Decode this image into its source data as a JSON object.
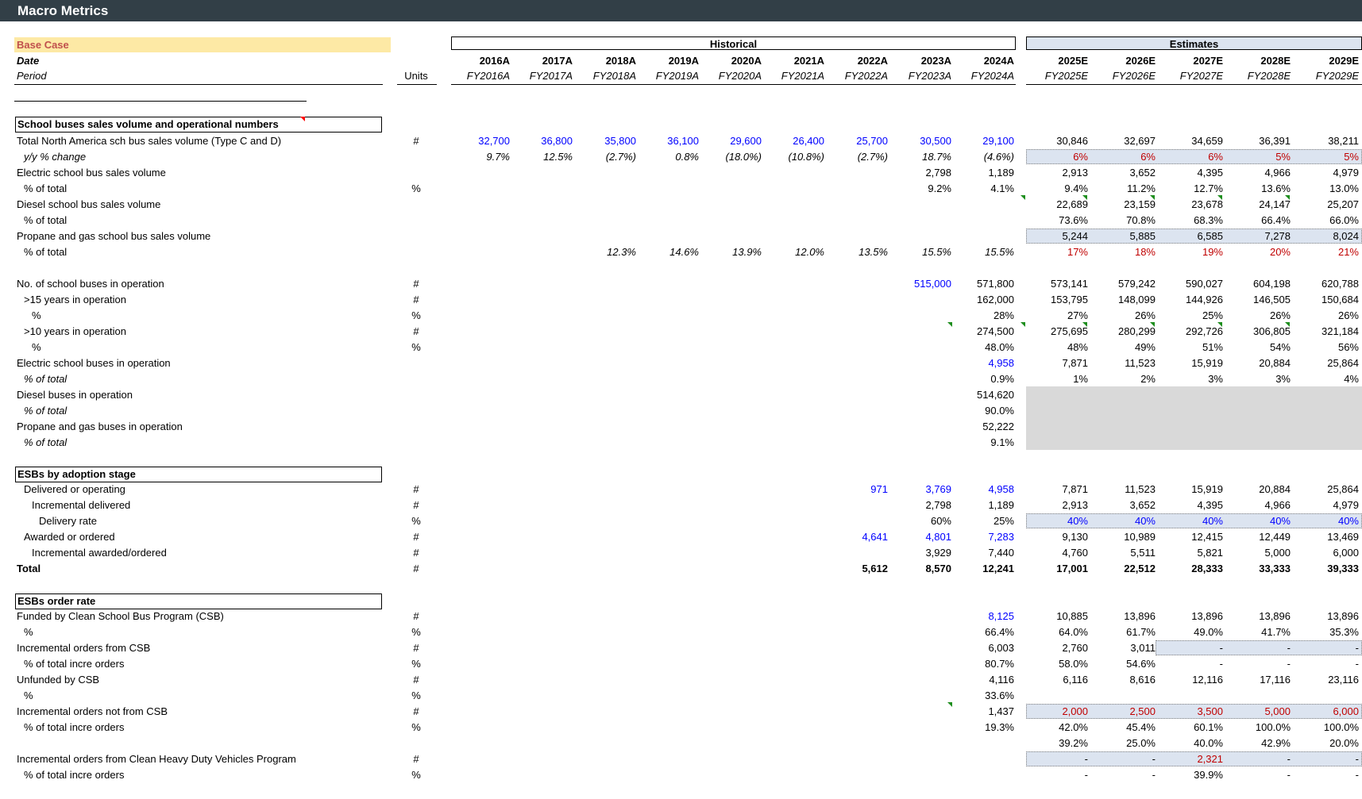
{
  "sheet_title": "Macro Metrics",
  "base_case": "Base Case",
  "date_label": "Date",
  "period_label": "Period",
  "units_header": "Units",
  "historical_label": "Historical",
  "estimates_label": "Estimates",
  "years": [
    "2016A",
    "2017A",
    "2018A",
    "2019A",
    "2020A",
    "2021A",
    "2022A",
    "2023A",
    "2024A",
    "2025E",
    "2026E",
    "2027E",
    "2028E",
    "2029E"
  ],
  "periods": [
    "FY2016A",
    "FY2017A",
    "FY2018A",
    "FY2019A",
    "FY2020A",
    "FY2021A",
    "FY2022A",
    "FY2023A",
    "FY2024A",
    "FY2025E",
    "FY2026E",
    "FY2027E",
    "FY2028E",
    "FY2029E"
  ],
  "sections": [
    {
      "title": "School buses sales volume and operational numbers"
    },
    {
      "title": "ESBs by adoption stage"
    },
    {
      "title": "ESBs order rate"
    }
  ],
  "rows": [
    {
      "label": "Total North America sch bus sales volume (Type C and D)",
      "unit": "#",
      "vals": [
        "32,700",
        "36,800",
        "35,800",
        "36,100",
        "29,600",
        "26,400",
        "25,700",
        "30,500",
        "29,100",
        "30,846",
        "32,697",
        "34,659",
        "36,391",
        "38,211"
      ]
    },
    {
      "label": "y/y % change",
      "unit": "",
      "vals": [
        "9.7%",
        "12.5%",
        "(2.7%)",
        "0.8%",
        "(18.0%)",
        "(10.8%)",
        "(2.7%)",
        "18.7%",
        "(4.6%)",
        "6%",
        "6%",
        "6%",
        "5%",
        "5%"
      ]
    },
    {
      "label": "Electric school bus sales volume",
      "unit": "",
      "vals": [
        "",
        "",
        "",
        "",
        "",
        "",
        "",
        "2,798",
        "1,189",
        "2,913",
        "3,652",
        "4,395",
        "4,966",
        "4,979"
      ]
    },
    {
      "label": "% of total",
      "unit": "%",
      "vals": [
        "",
        "",
        "",
        "",
        "",
        "",
        "",
        "9.2%",
        "4.1%",
        "9.4%",
        "11.2%",
        "12.7%",
        "13.6%",
        "13.0%"
      ]
    },
    {
      "label": "Diesel school bus sales volume",
      "unit": "",
      "vals": [
        "",
        "",
        "",
        "",
        "",
        "",
        "",
        "",
        "",
        "22,689",
        "23,159",
        "23,678",
        "24,147",
        "25,207"
      ]
    },
    {
      "label": "% of total",
      "unit": "",
      "vals": [
        "",
        "",
        "",
        "",
        "",
        "",
        "",
        "",
        "",
        "73.6%",
        "70.8%",
        "68.3%",
        "66.4%",
        "66.0%"
      ]
    },
    {
      "label": "Propane and gas school bus sales volume",
      "unit": "",
      "vals": [
        "",
        "",
        "",
        "",
        "",
        "",
        "",
        "",
        "",
        "5,244",
        "5,885",
        "6,585",
        "7,278",
        "8,024"
      ]
    },
    {
      "label": "% of total",
      "unit": "",
      "vals": [
        "",
        "",
        "12.3%",
        "14.6%",
        "13.9%",
        "12.0%",
        "13.5%",
        "15.5%",
        "15.5%",
        "17%",
        "18%",
        "19%",
        "20%",
        "21%"
      ]
    },
    {
      "label": "No. of school buses in operation",
      "unit": "#",
      "vals": [
        "",
        "",
        "",
        "",
        "",
        "",
        "",
        "515,000",
        "571,800",
        "573,141",
        "579,242",
        "590,027",
        "604,198",
        "620,788"
      ]
    },
    {
      "label": ">15 years in operation",
      "unit": "#",
      "vals": [
        "",
        "",
        "",
        "",
        "",
        "",
        "",
        "",
        "162,000",
        "153,795",
        "148,099",
        "144,926",
        "146,505",
        "150,684"
      ]
    },
    {
      "label": "%",
      "unit": "%",
      "vals": [
        "",
        "",
        "",
        "",
        "",
        "",
        "",
        "",
        "28%",
        "27%",
        "26%",
        "25%",
        "26%",
        "26%"
      ]
    },
    {
      "label": ">10 years in operation",
      "unit": "#",
      "vals": [
        "",
        "",
        "",
        "",
        "",
        "",
        "",
        "",
        "274,500",
        "275,695",
        "280,299",
        "292,726",
        "306,805",
        "321,184"
      ]
    },
    {
      "label": "%",
      "unit": "%",
      "vals": [
        "",
        "",
        "",
        "",
        "",
        "",
        "",
        "",
        "48.0%",
        "48%",
        "49%",
        "51%",
        "54%",
        "56%"
      ]
    },
    {
      "label": "Electric school buses in operation",
      "unit": "",
      "vals": [
        "",
        "",
        "",
        "",
        "",
        "",
        "",
        "",
        "4,958",
        "7,871",
        "11,523",
        "15,919",
        "20,884",
        "25,864"
      ]
    },
    {
      "label": "% of total",
      "unit": "",
      "vals": [
        "",
        "",
        "",
        "",
        "",
        "",
        "",
        "",
        "0.9%",
        "1%",
        "2%",
        "3%",
        "3%",
        "4%"
      ]
    },
    {
      "label": "Diesel buses in operation",
      "unit": "",
      "vals": [
        "",
        "",
        "",
        "",
        "",
        "",
        "",
        "",
        "514,620",
        "",
        "",
        "",
        "",
        ""
      ]
    },
    {
      "label": "% of total",
      "unit": "",
      "vals": [
        "",
        "",
        "",
        "",
        "",
        "",
        "",
        "",
        "90.0%",
        "",
        "",
        "",
        "",
        ""
      ]
    },
    {
      "label": "Propane and gas buses in operation",
      "unit": "",
      "vals": [
        "",
        "",
        "",
        "",
        "",
        "",
        "",
        "",
        "52,222",
        "",
        "",
        "",
        "",
        ""
      ]
    },
    {
      "label": "% of total",
      "unit": "",
      "vals": [
        "",
        "",
        "",
        "",
        "",
        "",
        "",
        "",
        "9.1%",
        "",
        "",
        "",
        "",
        ""
      ]
    },
    {
      "label": "Delivered or operating",
      "unit": "#",
      "vals": [
        "",
        "",
        "",
        "",
        "",
        "",
        "971",
        "3,769",
        "4,958",
        "7,871",
        "11,523",
        "15,919",
        "20,884",
        "25,864"
      ]
    },
    {
      "label": "Incremental delivered",
      "unit": "#",
      "vals": [
        "",
        "",
        "",
        "",
        "",
        "",
        "",
        "2,798",
        "1,189",
        "2,913",
        "3,652",
        "4,395",
        "4,966",
        "4,979"
      ]
    },
    {
      "label": "Delivery rate",
      "unit": "%",
      "vals": [
        "",
        "",
        "",
        "",
        "",
        "",
        "",
        "60%",
        "25%",
        "40%",
        "40%",
        "40%",
        "40%",
        "40%"
      ]
    },
    {
      "label": "Awarded or ordered",
      "unit": "#",
      "vals": [
        "",
        "",
        "",
        "",
        "",
        "",
        "4,641",
        "4,801",
        "7,283",
        "9,130",
        "10,989",
        "12,415",
        "12,449",
        "13,469"
      ]
    },
    {
      "label": "Incremental awarded/ordered",
      "unit": "#",
      "vals": [
        "",
        "",
        "",
        "",
        "",
        "",
        "",
        "3,929",
        "7,440",
        "4,760",
        "5,511",
        "5,821",
        "5,000",
        "6,000"
      ]
    },
    {
      "label": "Total",
      "unit": "#",
      "vals": [
        "",
        "",
        "",
        "",
        "",
        "",
        "5,612",
        "8,570",
        "12,241",
        "17,001",
        "22,512",
        "28,333",
        "33,333",
        "39,333"
      ]
    },
    {
      "label": "Funded by Clean School Bus Program (CSB)",
      "unit": "#",
      "vals": [
        "",
        "",
        "",
        "",
        "",
        "",
        "",
        "",
        "8,125",
        "10,885",
        "13,896",
        "13,896",
        "13,896",
        "13,896"
      ]
    },
    {
      "label": "%",
      "unit": "%",
      "vals": [
        "",
        "",
        "",
        "",
        "",
        "",
        "",
        "",
        "66.4%",
        "64.0%",
        "61.7%",
        "49.0%",
        "41.7%",
        "35.3%"
      ]
    },
    {
      "label": "Incremental orders from CSB",
      "unit": "#",
      "vals": [
        "",
        "",
        "",
        "",
        "",
        "",
        "",
        "",
        "6,003",
        "2,760",
        "3,011",
        "-",
        "-",
        "-"
      ]
    },
    {
      "label": "% of total incre orders",
      "unit": "%",
      "vals": [
        "",
        "",
        "",
        "",
        "",
        "",
        "",
        "",
        "80.7%",
        "58.0%",
        "54.6%",
        "-",
        "-",
        "-"
      ]
    },
    {
      "label": "Unfunded by CSB",
      "unit": "#",
      "vals": [
        "",
        "",
        "",
        "",
        "",
        "",
        "",
        "",
        "4,116",
        "6,116",
        "8,616",
        "12,116",
        "17,116",
        "23,116"
      ]
    },
    {
      "label": "%",
      "unit": "%",
      "vals": [
        "",
        "",
        "",
        "",
        "",
        "",
        "",
        "",
        "33.6%",
        "",
        "",
        "",
        "",
        ""
      ]
    },
    {
      "label": "Incremental orders not from CSB",
      "unit": "#",
      "vals": [
        "",
        "",
        "",
        "",
        "",
        "",
        "",
        "",
        "1,437",
        "2,000",
        "2,500",
        "3,500",
        "5,000",
        "6,000"
      ]
    },
    {
      "label": "% of total incre orders",
      "unit": "%",
      "vals": [
        "",
        "",
        "",
        "",
        "",
        "",
        "",
        "",
        "19.3%",
        "42.0%",
        "45.4%",
        "60.1%",
        "100.0%",
        "100.0%"
      ]
    },
    {
      "label": "",
      "unit": "",
      "vals": [
        "",
        "",
        "",
        "",
        "",
        "",
        "",
        "",
        "",
        "39.2%",
        "25.0%",
        "40.0%",
        "42.9%",
        "20.0%"
      ]
    },
    {
      "label": "Incremental orders from Clean Heavy Duty Vehicles Program",
      "unit": "#",
      "vals": [
        "",
        "",
        "",
        "",
        "",
        "",
        "",
        "",
        "",
        "-",
        "-",
        "2,321",
        "-",
        "-"
      ]
    },
    {
      "label": "% of total incre orders",
      "unit": "%",
      "vals": [
        "",
        "",
        "",
        "",
        "",
        "",
        "",
        "",
        "",
        "-",
        "-",
        "39.9%",
        "-",
        "-"
      ]
    }
  ]
}
